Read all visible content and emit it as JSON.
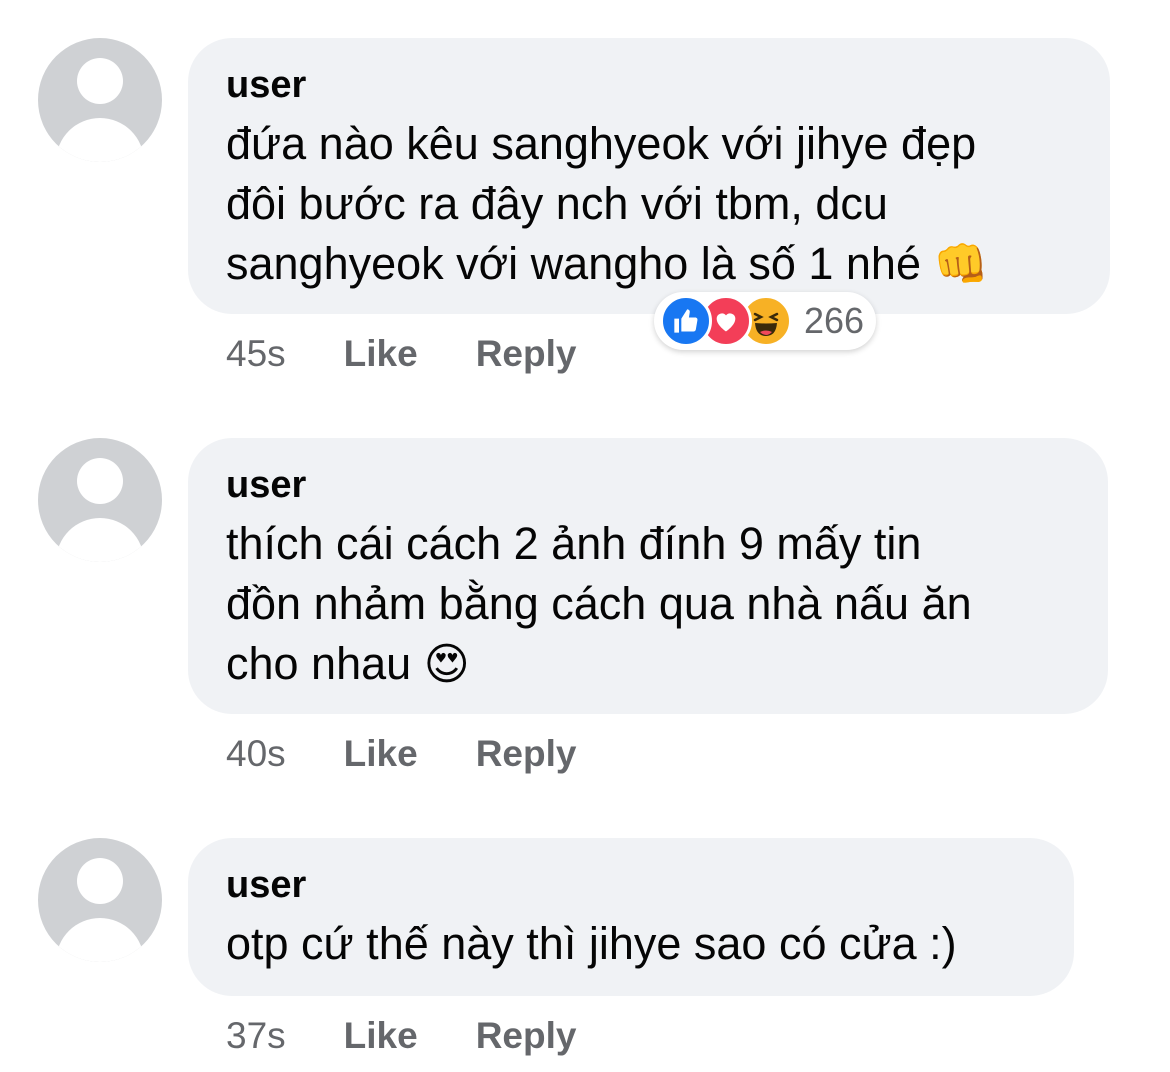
{
  "comments": [
    {
      "author": "user",
      "lines": [
        "đứa nào kêu sanghyeok với jihye đẹp",
        "đôi bước ra đây nch với tbm, dcu",
        "sanghyeok với wangho là số 1 nhé"
      ],
      "emoji": "👊",
      "time": "45s",
      "like_label": "Like",
      "reply_label": "Reply",
      "reactions": {
        "icons": [
          "like-icon",
          "love-icon",
          "haha-icon"
        ],
        "count": "266"
      }
    },
    {
      "author": "user",
      "lines": [
        "thích cái cách 2 ảnh đính 9 mấy tin",
        "đồn nhảm bằng cách qua nhà nấu ăn",
        "cho nhau"
      ],
      "emoji": "😍",
      "time": "40s",
      "like_label": "Like",
      "reply_label": "Reply"
    },
    {
      "author": "user",
      "lines": [
        "otp cứ thế này thì jihye sao có cửa :)"
      ],
      "time": "37s",
      "like_label": "Like",
      "reply_label": "Reply"
    }
  ],
  "colors": {
    "bubble": "#f0f2f5",
    "meta_text": "#65676b",
    "like": "#1877f2",
    "love": "#f33e58",
    "haha": "#f7b125"
  }
}
